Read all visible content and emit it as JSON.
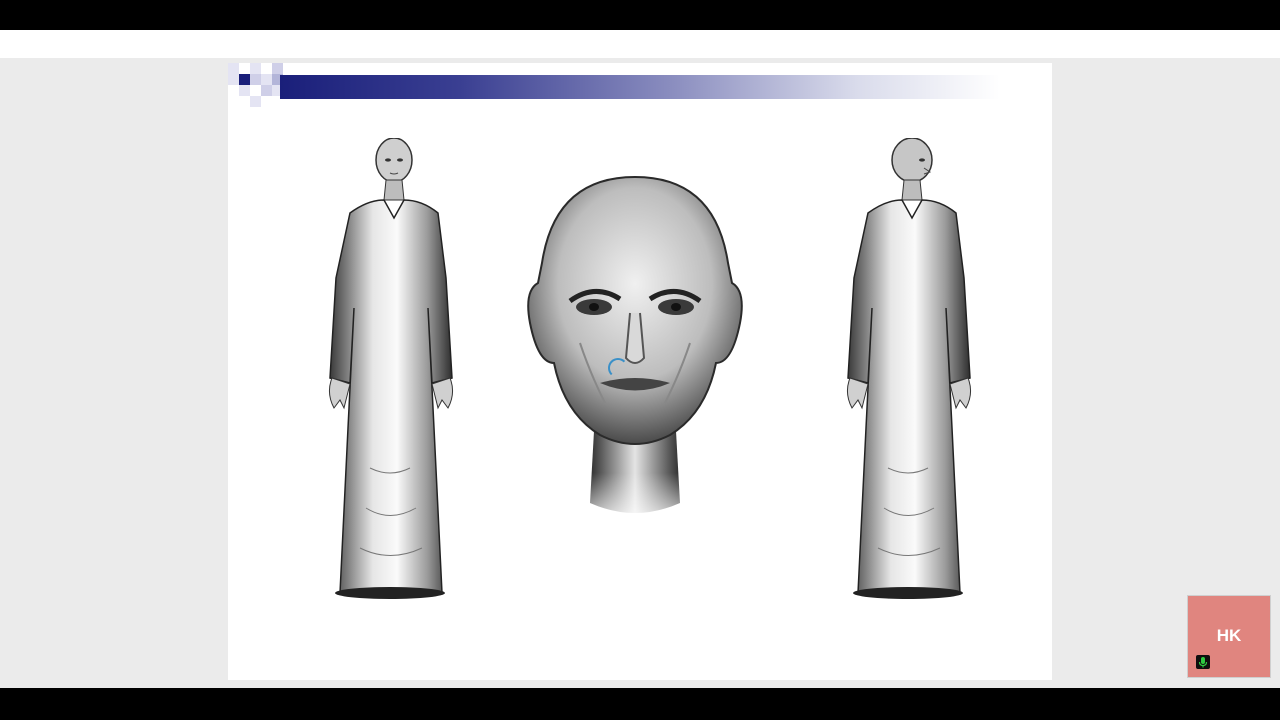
{
  "participant": {
    "initials": "HK",
    "tile_color": "#e0857f",
    "mic_state": "unmuted",
    "mic_color": "#2ec940"
  },
  "slide": {
    "header_bar_color": "#1a1f7a",
    "images": [
      "full-figure-front",
      "face-portrait",
      "full-figure-three-quarter"
    ]
  },
  "icons": [
    "loading-spinner-icon",
    "microphone-icon"
  ]
}
